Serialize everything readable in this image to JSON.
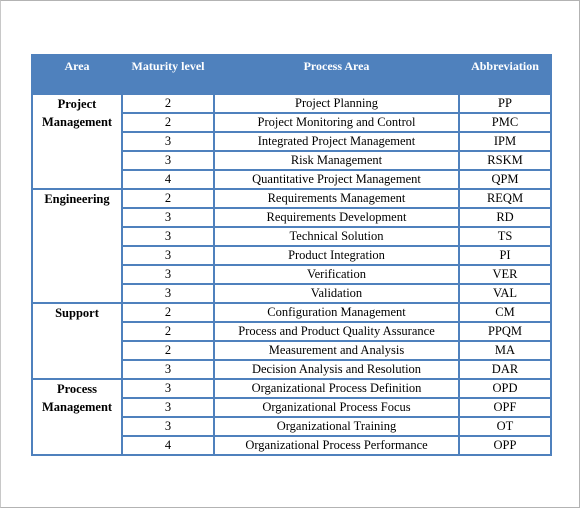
{
  "table": {
    "headers": {
      "area": "Area",
      "maturity_level": "Maturity level",
      "process_area": "Process Area",
      "abbreviation": "Abbreviation"
    },
    "groups": [
      {
        "area": "Project Management",
        "rows": [
          {
            "level": "2",
            "process": "Project Planning",
            "abbr": "PP"
          },
          {
            "level": "2",
            "process": "Project Monitoring and Control",
            "abbr": "PMC"
          },
          {
            "level": "3",
            "process": "Integrated Project Management",
            "abbr": "IPM"
          },
          {
            "level": "3",
            "process": "Risk Management",
            "abbr": "RSKM"
          },
          {
            "level": "4",
            "process": "Quantitative Project Management",
            "abbr": "QPM"
          }
        ]
      },
      {
        "area": "Engineering",
        "rows": [
          {
            "level": "2",
            "process": "Requirements Management",
            "abbr": "REQM"
          },
          {
            "level": "3",
            "process": "Requirements Development",
            "abbr": "RD"
          },
          {
            "level": "3",
            "process": "Technical Solution",
            "abbr": "TS"
          },
          {
            "level": "3",
            "process": "Product Integration",
            "abbr": "PI"
          },
          {
            "level": "3",
            "process": "Verification",
            "abbr": "VER"
          },
          {
            "level": "3",
            "process": "Validation",
            "abbr": "VAL"
          }
        ]
      },
      {
        "area": "Support",
        "rows": [
          {
            "level": "2",
            "process": "Configuration Management",
            "abbr": "CM"
          },
          {
            "level": "2",
            "process": "Process and Product Quality Assurance",
            "abbr": "PPQM"
          },
          {
            "level": "2",
            "process": "Measurement and Analysis",
            "abbr": "MA"
          },
          {
            "level": "3",
            "process": "Decision Analysis and Resolution",
            "abbr": "DAR"
          }
        ]
      },
      {
        "area": "Process Management",
        "rows": [
          {
            "level": "3",
            "process": "Organizational Process Definition",
            "abbr": "OPD"
          },
          {
            "level": "3",
            "process": "Organizational Process Focus",
            "abbr": "OPF"
          },
          {
            "level": "3",
            "process": "Organizational Training",
            "abbr": "OT"
          },
          {
            "level": "4",
            "process": "Organizational Process Performance",
            "abbr": "OPP"
          }
        ]
      }
    ]
  },
  "colors": {
    "header_bg": "#4f81bd",
    "header_text": "#ffffff",
    "border": "#4f81bd"
  }
}
